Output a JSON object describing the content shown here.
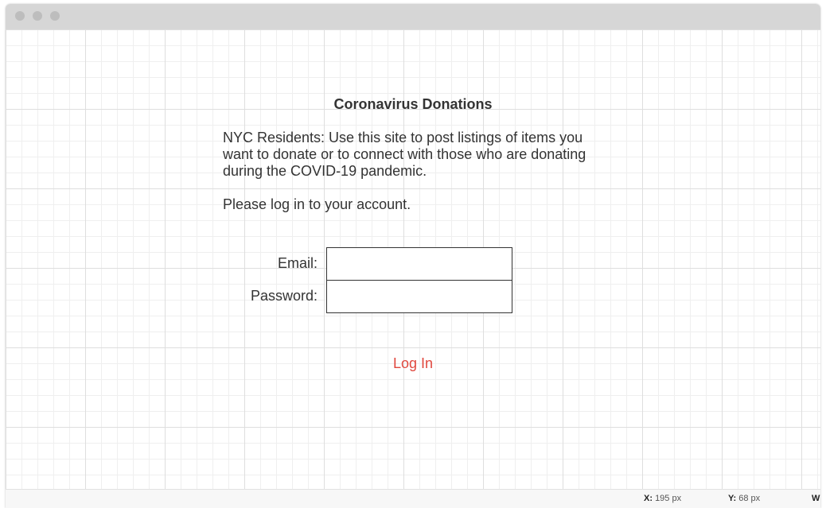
{
  "titlebar": {
    "buttons": [
      "close",
      "minimize",
      "maximize"
    ]
  },
  "page": {
    "title": "Coronavirus Donations",
    "intro": "NYC Residents: Use this site to post listings of items you want to donate or to connect with those who are donating during the COVID-19 pandemic.",
    "prompt": "Please log in to your account."
  },
  "form": {
    "email_label": "Email:",
    "email_value": "",
    "password_label": "Password:",
    "password_value": "",
    "login_label": "Log In"
  },
  "statusbar": {
    "x_label": "X:",
    "x_value": "195 px",
    "y_label": "Y:",
    "y_value": "68 px",
    "w_label": "W:"
  },
  "colors": {
    "link": "#e0483e",
    "text": "#333333",
    "titlebar": "#d6d6d6"
  }
}
